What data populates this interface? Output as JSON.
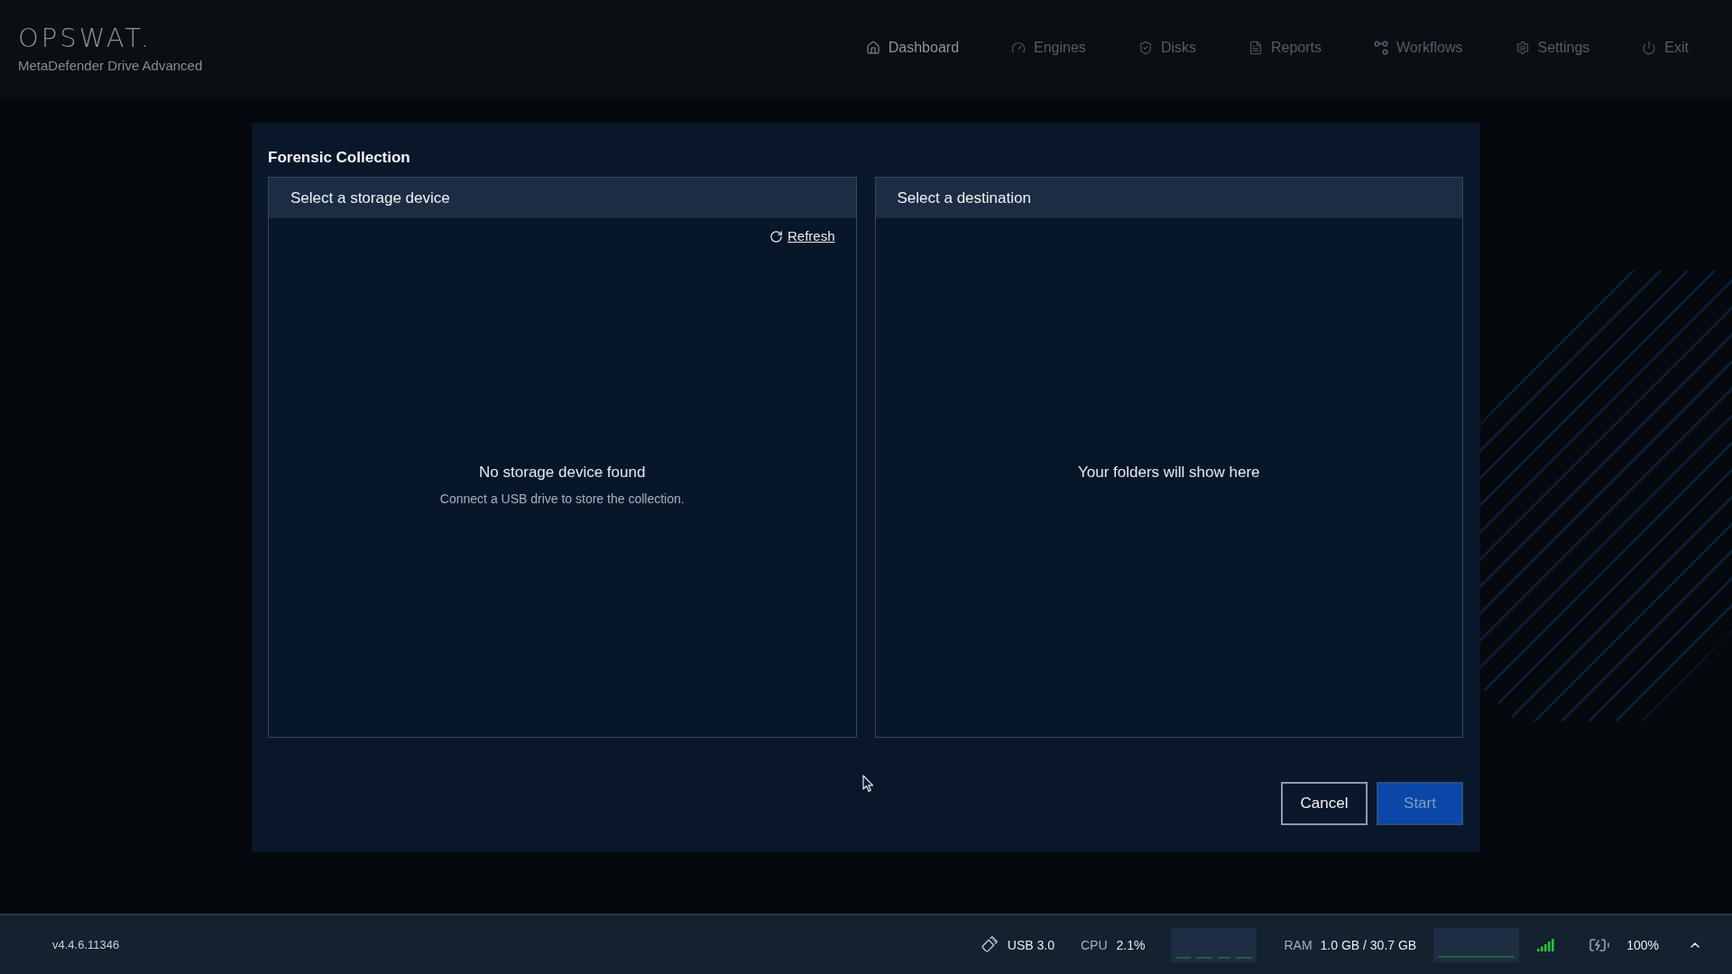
{
  "header": {
    "logo": "OPSWAT.",
    "product": "MetaDefender Drive Advanced",
    "nav": [
      {
        "label": "Dashboard",
        "selected": true
      },
      {
        "label": "Engines",
        "selected": false
      },
      {
        "label": "Disks",
        "selected": false
      },
      {
        "label": "Reports",
        "selected": false
      },
      {
        "label": "Workflows",
        "selected": false
      },
      {
        "label": "Settings",
        "selected": false
      },
      {
        "label": "Exit",
        "selected": false
      }
    ]
  },
  "dialog": {
    "title": "Forensic Collection",
    "panels": [
      {
        "title": "Select a storage device",
        "action": "Refresh",
        "empty_title": "No storage device found",
        "empty_hint": "Connect a USB drive to store the collection."
      },
      {
        "title": "Select a destination",
        "empty_title": "Your folders will show here"
      }
    ],
    "buttons": [
      {
        "label": "Cancel",
        "kind": "secondary",
        "disabled": false
      },
      {
        "label": "Start",
        "kind": "primary",
        "disabled": true
      }
    ]
  },
  "status_bar": {
    "version": "v4.4.6.11346",
    "usb": "USB 3.0",
    "cpu": {
      "label": "CPU",
      "value": "2.1%"
    },
    "ram": {
      "label": "RAM",
      "value": "1.0 GB / 30.7 GB"
    },
    "battery": "100%"
  }
}
